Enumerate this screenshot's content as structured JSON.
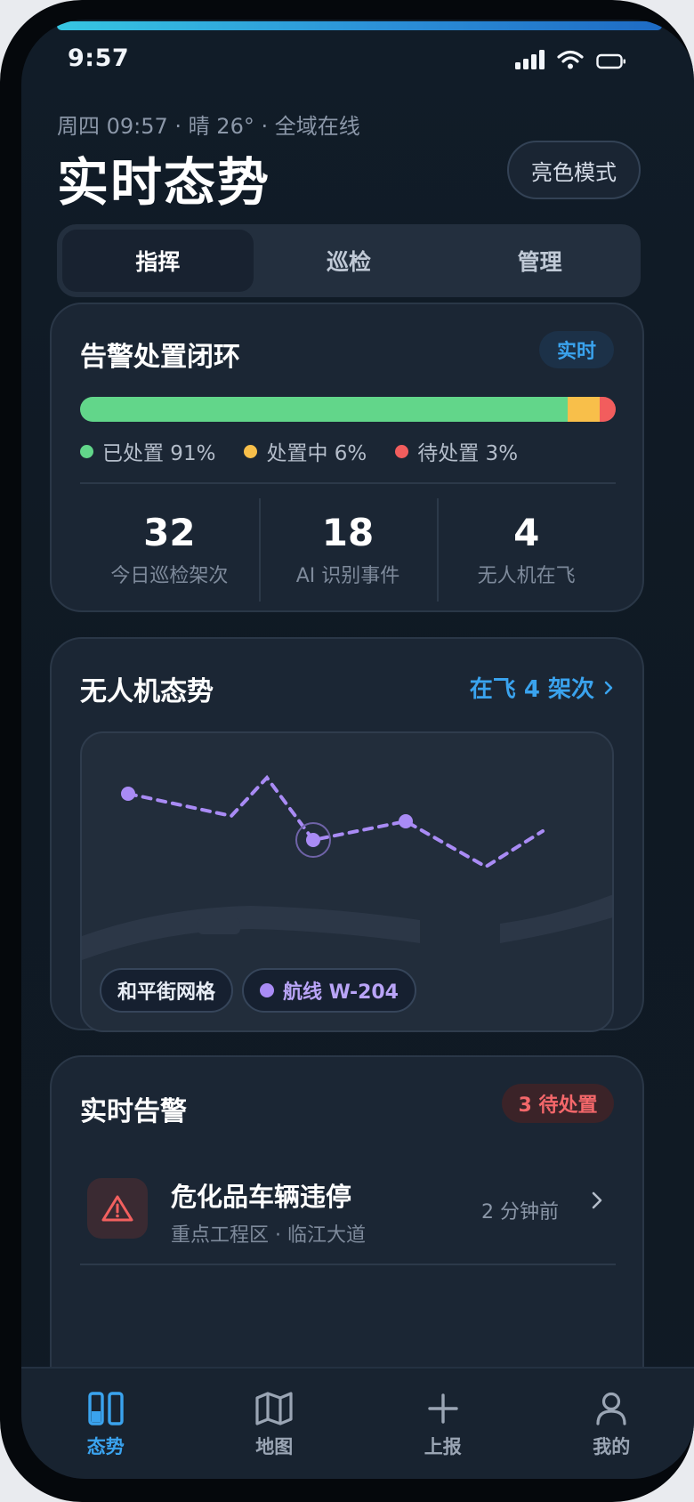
{
  "status_bar": {
    "time": "9:57"
  },
  "header": {
    "subline": "周四 09:57 · 晴 26° · 全域在线",
    "title": "实时态势",
    "mode_button": "亮色模式"
  },
  "segments": [
    {
      "label": "指挥",
      "active": true
    },
    {
      "label": "巡检",
      "active": false
    },
    {
      "label": "管理",
      "active": false
    }
  ],
  "alert_loop_card": {
    "title": "告警处置闭环",
    "badge": "实时",
    "segments": [
      {
        "label": "已处置 91%",
        "percent": 91,
        "color": "#62d68a"
      },
      {
        "label": "处置中 6%",
        "percent": 6,
        "color": "#f8bf4a"
      },
      {
        "label": "待处置 3%",
        "percent": 3,
        "color": "#f25d5d"
      }
    ],
    "stats": [
      {
        "value": "32",
        "label": "今日巡检架次"
      },
      {
        "value": "18",
        "label": "AI 识别事件"
      },
      {
        "value": "4",
        "label": "无人机在飞"
      }
    ]
  },
  "drone_card": {
    "title": "无人机态势",
    "link": "在飞 4 架次",
    "chips": [
      {
        "label": "和平街网格"
      },
      {
        "label": "航线 W-204"
      }
    ],
    "route_color": "#a98bf5"
  },
  "alerts_card": {
    "title": "实时告警",
    "badge": "3 待处置",
    "items": [
      {
        "title": "危化品车辆违停",
        "subtitle": "重点工程区 · 临江大道",
        "time": "2 分钟前"
      }
    ]
  },
  "tabbar": [
    {
      "label": "态势",
      "icon": "dashboard-icon",
      "active": true
    },
    {
      "label": "地图",
      "icon": "map-icon",
      "active": false
    },
    {
      "label": "上报",
      "icon": "plus-icon",
      "active": false
    },
    {
      "label": "我的",
      "icon": "user-icon",
      "active": false
    }
  ],
  "colors": {
    "accent": "#3aa3ee",
    "danger": "#f25d5d",
    "success": "#62d68a",
    "warning": "#f8bf4a"
  }
}
